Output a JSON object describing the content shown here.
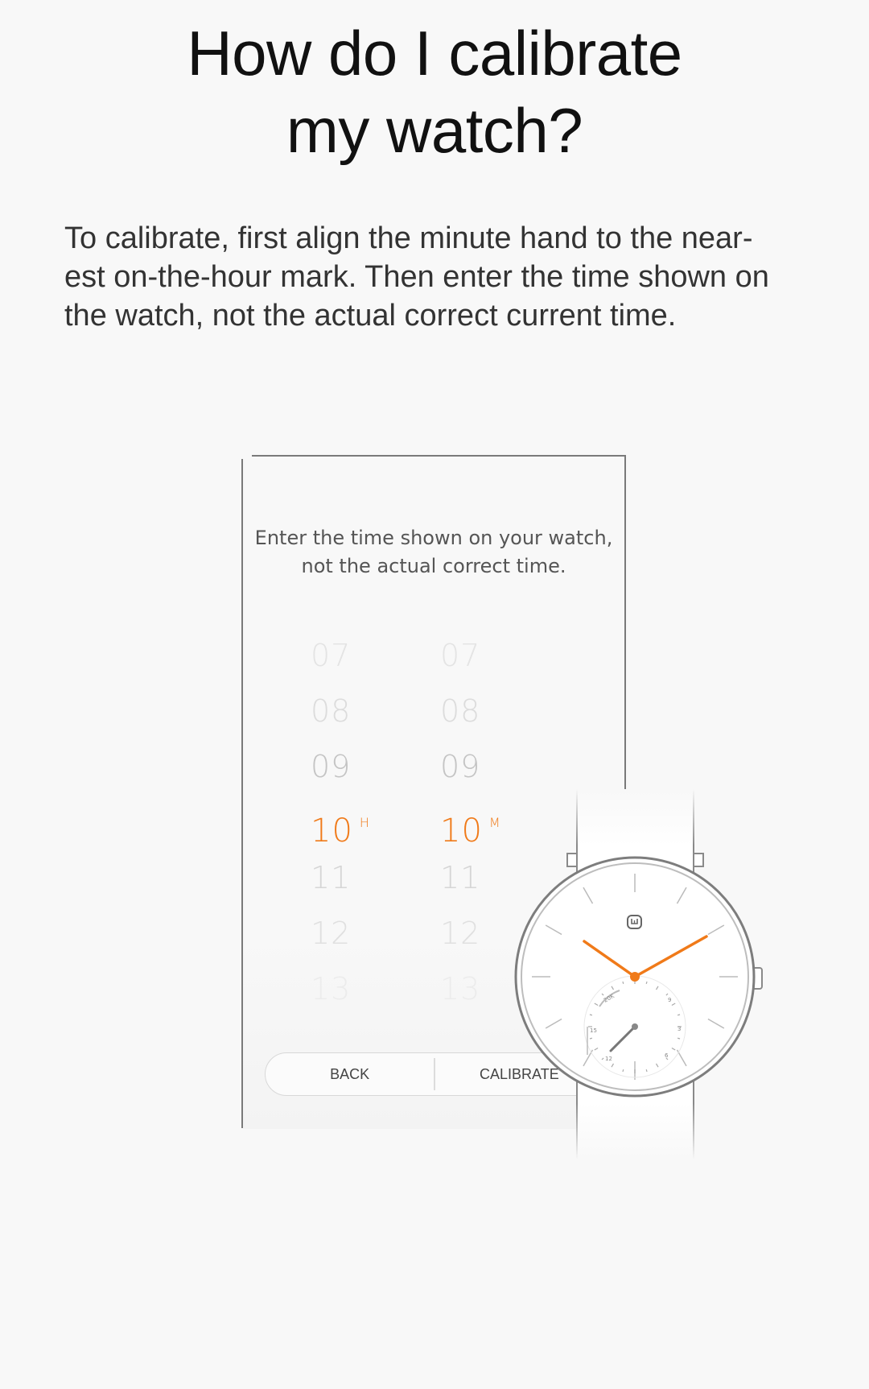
{
  "heading": {
    "line1": "How do I calibrate",
    "line2": "my watch?"
  },
  "description": {
    "line1": "To calibrate, first align the minute hand to the near-",
    "line2": "est on-the-hour mark. Then enter the time shown on",
    "line3": "the watch, not the actual correct current time."
  },
  "phone": {
    "prompt_line1": "Enter the time shown on your watch,",
    "prompt_line2": "not the actual correct time.",
    "hours": [
      "07",
      "08",
      "09",
      "10",
      "11",
      "12",
      "13"
    ],
    "minutes": [
      "07",
      "08",
      "09",
      "10",
      "11",
      "12",
      "13"
    ],
    "selected_hour": "10",
    "hour_unit": "H",
    "selected_minute": "10",
    "minute_unit": "M",
    "back_label": "BACK",
    "calibrate_label": "CALIBRATE"
  },
  "watch": {
    "logo_icon": "mi-logo-icon",
    "subdial_labels": [
      "20K",
      "15",
      "12",
      "9",
      "6",
      "3"
    ],
    "accent_color": "#f07a19"
  }
}
